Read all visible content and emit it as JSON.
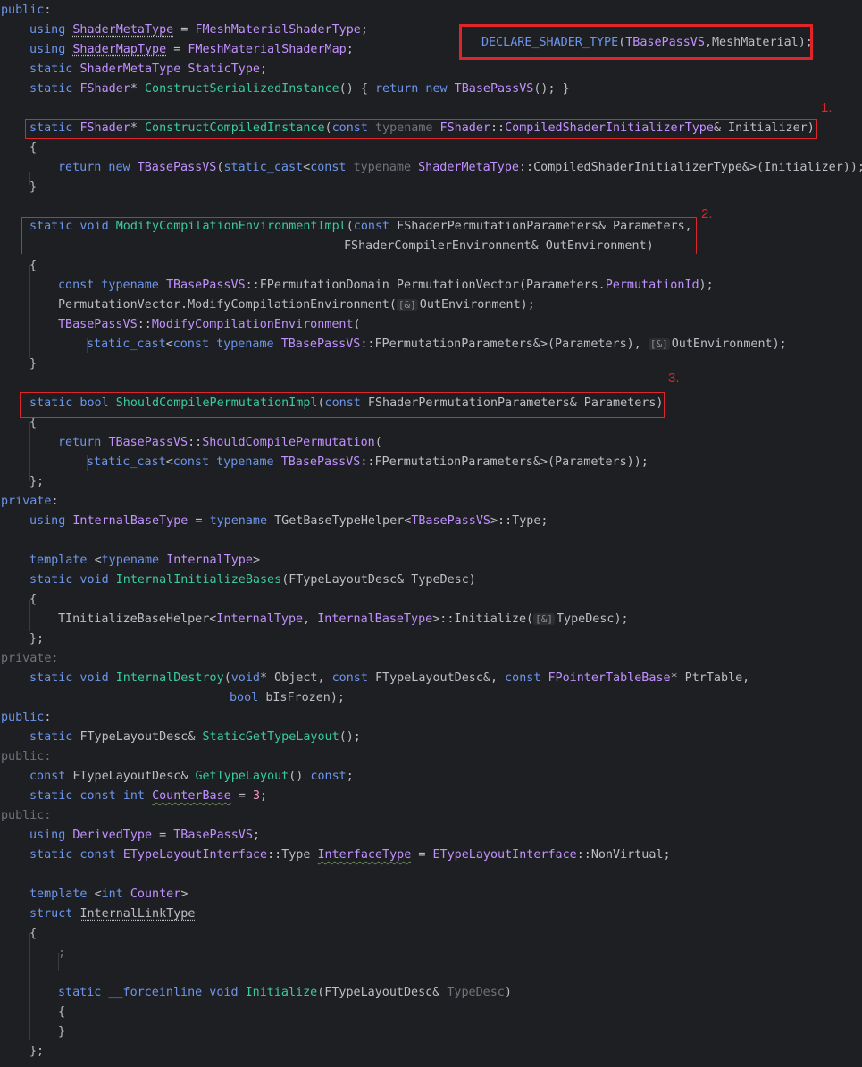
{
  "editor": {
    "background": "#1e1f22",
    "colors": {
      "keyword": "#6c95eb",
      "type": "#c191ff",
      "function": "#39cc9b",
      "number": "#ed94c0",
      "text": "#bcbec4",
      "annotation_red": "#e0242a"
    },
    "lines": [
      {
        "indent": 0,
        "tokens": [
          [
            "kw",
            "public"
          ],
          [
            "text",
            ":"
          ]
        ]
      },
      {
        "indent": 1,
        "tokens": [
          [
            "kw",
            "using "
          ],
          [
            "type-dotted",
            "ShaderMetaType"
          ],
          [
            "text",
            " = "
          ],
          [
            "type",
            "FMeshMaterialShaderType"
          ],
          [
            "text",
            ";"
          ]
        ]
      },
      {
        "indent": 1,
        "tokens": [
          [
            "kw",
            "using "
          ],
          [
            "type-dotted",
            "ShaderMapType"
          ],
          [
            "text",
            " = "
          ],
          [
            "type",
            "FMeshMaterialShaderMap"
          ],
          [
            "text",
            ";"
          ]
        ]
      },
      {
        "indent": 1,
        "tokens": [
          [
            "kw",
            "static "
          ],
          [
            "type",
            "ShaderMetaType "
          ],
          [
            "type",
            "StaticType"
          ],
          [
            "text",
            ";"
          ]
        ]
      },
      {
        "indent": 1,
        "tokens": [
          [
            "kw",
            "static "
          ],
          [
            "type",
            "FShader"
          ],
          [
            "text",
            "* "
          ],
          [
            "fn",
            "ConstructSerializedInstance"
          ],
          [
            "text",
            "() { "
          ],
          [
            "kw",
            "return new "
          ],
          [
            "type",
            "TBasePassVS"
          ],
          [
            "text",
            "(); }"
          ]
        ]
      },
      {
        "indent": 0,
        "tokens": []
      },
      {
        "indent": 1,
        "tokens": [
          [
            "kw",
            "static "
          ],
          [
            "type",
            "FShader"
          ],
          [
            "text",
            "* "
          ],
          [
            "fn",
            "ConstructCompiledInstance"
          ],
          [
            "text",
            "("
          ],
          [
            "kw",
            "const "
          ],
          [
            "dim",
            "typename "
          ],
          [
            "type",
            "FShader"
          ],
          [
            "text",
            "::"
          ],
          [
            "type",
            "CompiledShaderInitializerType"
          ],
          [
            "text",
            "& Initializer)"
          ]
        ]
      },
      {
        "indent": 1,
        "tokens": [
          [
            "text",
            "{"
          ]
        ]
      },
      {
        "indent": 2,
        "tokens": [
          [
            "kw",
            "return new "
          ],
          [
            "type",
            "TBasePassVS"
          ],
          [
            "text",
            "("
          ],
          [
            "kw",
            "static_cast"
          ],
          [
            "text",
            "<"
          ],
          [
            "kw",
            "const "
          ],
          [
            "dim",
            "typename "
          ],
          [
            "type",
            "ShaderMetaType"
          ],
          [
            "text",
            "::"
          ],
          [
            "text",
            "CompiledShaderInitializerType"
          ],
          [
            "text",
            "&>(Initializer));"
          ]
        ]
      },
      {
        "indent": 1,
        "tokens": [
          [
            "text",
            "}"
          ]
        ]
      },
      {
        "indent": 0,
        "tokens": []
      },
      {
        "indent": 1,
        "tokens": [
          [
            "kw",
            "static void "
          ],
          [
            "fn",
            "ModifyCompilationEnvironmentImpl"
          ],
          [
            "text",
            "("
          ],
          [
            "kw",
            "const "
          ],
          [
            "text",
            "FShaderPermutationParameters& Parameters,"
          ]
        ]
      },
      {
        "indent": 12,
        "tokens": [
          [
            "text",
            "FShaderCompilerEnvironment& OutEnvironment)"
          ]
        ]
      },
      {
        "indent": 1,
        "tokens": [
          [
            "text",
            "{"
          ]
        ]
      },
      {
        "indent": 2,
        "tokens": [
          [
            "kw",
            "const typename "
          ],
          [
            "type",
            "TBasePassVS"
          ],
          [
            "text",
            "::FPermutationDomain PermutationVector(Parameters."
          ],
          [
            "type",
            "PermutationId"
          ],
          [
            "text",
            ");"
          ]
        ]
      },
      {
        "indent": 2,
        "tokens": [
          [
            "text",
            "PermutationVector.ModifyCompilationEnvironment("
          ],
          [
            "hint",
            "[&]"
          ],
          [
            "text",
            "OutEnvironment);"
          ]
        ]
      },
      {
        "indent": 2,
        "tokens": [
          [
            "type",
            "TBasePassVS"
          ],
          [
            "text",
            "::"
          ],
          [
            "type",
            "ModifyCompilationEnvironment"
          ],
          [
            "text",
            "("
          ]
        ]
      },
      {
        "indent": 3,
        "tokens": [
          [
            "kw",
            "static_cast"
          ],
          [
            "text",
            "<"
          ],
          [
            "kw",
            "const typename "
          ],
          [
            "type",
            "TBasePassVS"
          ],
          [
            "text",
            "::FPermutationParameters&>(Parameters), "
          ],
          [
            "hint",
            "[&]"
          ],
          [
            "text",
            "OutEnvironment);"
          ]
        ]
      },
      {
        "indent": 1,
        "tokens": [
          [
            "text",
            "}"
          ]
        ]
      },
      {
        "indent": 0,
        "tokens": []
      },
      {
        "indent": 1,
        "tokens": [
          [
            "kw",
            "static bool "
          ],
          [
            "fn",
            "ShouldCompilePermutationImpl"
          ],
          [
            "text",
            "("
          ],
          [
            "kw",
            "const "
          ],
          [
            "text",
            "FShaderPermutationParameters& Parameters)"
          ]
        ]
      },
      {
        "indent": 1,
        "tokens": [
          [
            "text",
            "{"
          ]
        ]
      },
      {
        "indent": 2,
        "tokens": [
          [
            "kw",
            "return "
          ],
          [
            "type",
            "TBasePassVS"
          ],
          [
            "text",
            "::"
          ],
          [
            "type",
            "ShouldCompilePermutation"
          ],
          [
            "text",
            "("
          ]
        ]
      },
      {
        "indent": 3,
        "tokens": [
          [
            "kw",
            "static_cast"
          ],
          [
            "text",
            "<"
          ],
          [
            "kw",
            "const typename "
          ],
          [
            "type",
            "TBasePassVS"
          ],
          [
            "text",
            "::FPermutationParameters&>(Parameters));"
          ]
        ]
      },
      {
        "indent": 1,
        "tokens": [
          [
            "text",
            "};"
          ]
        ]
      },
      {
        "indent": 0,
        "tokens": [
          [
            "kw",
            "private"
          ],
          [
            "text",
            ":"
          ]
        ]
      },
      {
        "indent": 1,
        "tokens": [
          [
            "kw",
            "using "
          ],
          [
            "type",
            "InternalBaseType"
          ],
          [
            "text",
            " = "
          ],
          [
            "kw",
            "typename "
          ],
          [
            "text",
            "TGetBaseTypeHelper<"
          ],
          [
            "type",
            "TBasePassVS"
          ],
          [
            "text",
            ">::Type;"
          ]
        ]
      },
      {
        "indent": 0,
        "tokens": []
      },
      {
        "indent": 1,
        "tokens": [
          [
            "kw",
            "template "
          ],
          [
            "text",
            "<"
          ],
          [
            "kw",
            "typename "
          ],
          [
            "type",
            "InternalType"
          ],
          [
            "text",
            ">"
          ]
        ]
      },
      {
        "indent": 1,
        "tokens": [
          [
            "kw",
            "static void "
          ],
          [
            "fn",
            "InternalInitializeBases"
          ],
          [
            "text",
            "(FTypeLayoutDesc& TypeDesc)"
          ]
        ]
      },
      {
        "indent": 1,
        "tokens": [
          [
            "text",
            "{"
          ]
        ]
      },
      {
        "indent": 2,
        "tokens": [
          [
            "text",
            "TInitializeBaseHelper<"
          ],
          [
            "type",
            "InternalType"
          ],
          [
            "text",
            ", "
          ],
          [
            "type",
            "InternalBaseType"
          ],
          [
            "text",
            ">::Initialize("
          ],
          [
            "hint",
            "[&]"
          ],
          [
            "text",
            "TypeDesc);"
          ]
        ]
      },
      {
        "indent": 1,
        "tokens": [
          [
            "text",
            "};"
          ]
        ]
      },
      {
        "indent": 0,
        "tokens": [
          [
            "dim",
            "private:"
          ]
        ]
      },
      {
        "indent": 1,
        "tokens": [
          [
            "kw",
            "static void "
          ],
          [
            "fn",
            "InternalDestroy"
          ],
          [
            "text",
            "("
          ],
          [
            "kw",
            "void"
          ],
          [
            "text",
            "* Object, "
          ],
          [
            "kw",
            "const "
          ],
          [
            "text",
            "FTypeLayoutDesc&, "
          ],
          [
            "kw",
            "const "
          ],
          [
            "type",
            "FPointerTableBase"
          ],
          [
            "text",
            "* PtrTable,"
          ]
        ]
      },
      {
        "indent": 8,
        "tokens": [
          [
            "kw",
            "bool "
          ],
          [
            "text",
            "bIsFrozen);"
          ]
        ]
      },
      {
        "indent": 0,
        "tokens": [
          [
            "kw",
            "public"
          ],
          [
            "text",
            ":"
          ]
        ]
      },
      {
        "indent": 1,
        "tokens": [
          [
            "kw",
            "static "
          ],
          [
            "text",
            "FTypeLayoutDesc& "
          ],
          [
            "fn",
            "StaticGetTypeLayout"
          ],
          [
            "text",
            "();"
          ]
        ]
      },
      {
        "indent": 0,
        "tokens": [
          [
            "dim",
            "public:"
          ]
        ]
      },
      {
        "indent": 1,
        "tokens": [
          [
            "kw",
            "const "
          ],
          [
            "text",
            "FTypeLayoutDesc& "
          ],
          [
            "fn",
            "GetTypeLayout"
          ],
          [
            "text",
            "() "
          ],
          [
            "kw",
            "const"
          ],
          [
            "text",
            ";"
          ]
        ]
      },
      {
        "indent": 1,
        "tokens": [
          [
            "kw",
            "static const int "
          ],
          [
            "type-wavy",
            "CounterBase"
          ],
          [
            "text",
            " = "
          ],
          [
            "num",
            "3"
          ],
          [
            "text",
            ";"
          ]
        ]
      },
      {
        "indent": 0,
        "tokens": [
          [
            "dim",
            "public:"
          ]
        ]
      },
      {
        "indent": 1,
        "tokens": [
          [
            "kw",
            "using "
          ],
          [
            "type",
            "DerivedType"
          ],
          [
            "text",
            " = "
          ],
          [
            "type",
            "TBasePassVS"
          ],
          [
            "text",
            ";"
          ]
        ]
      },
      {
        "indent": 1,
        "tokens": [
          [
            "kw",
            "static const "
          ],
          [
            "type",
            "ETypeLayoutInterface"
          ],
          [
            "text",
            "::Type "
          ],
          [
            "type-wavy",
            "InterfaceType"
          ],
          [
            "text",
            " = "
          ],
          [
            "type",
            "ETypeLayoutInterface"
          ],
          [
            "text",
            "::NonVirtual;"
          ]
        ]
      },
      {
        "indent": 0,
        "tokens": []
      },
      {
        "indent": 1,
        "tokens": [
          [
            "kw",
            "template "
          ],
          [
            "text",
            "<"
          ],
          [
            "kw",
            "int "
          ],
          [
            "type",
            "Counter"
          ],
          [
            "text",
            ">"
          ]
        ]
      },
      {
        "indent": 1,
        "tokens": [
          [
            "kw",
            "struct "
          ],
          [
            "text-dotted",
            "InternalLinkType"
          ]
        ]
      },
      {
        "indent": 1,
        "tokens": [
          [
            "text",
            "{"
          ]
        ]
      },
      {
        "indent": 2,
        "tokens": [
          [
            "dim",
            ";"
          ]
        ]
      },
      {
        "indent": 0,
        "tokens": []
      },
      {
        "indent": 2,
        "tokens": [
          [
            "kw",
            "static __forceinline void "
          ],
          [
            "fn",
            "Initialize"
          ],
          [
            "text",
            "(FTypeLayoutDesc& "
          ],
          [
            "dim",
            "TypeDesc"
          ],
          [
            "text",
            ")"
          ]
        ]
      },
      {
        "indent": 2,
        "tokens": [
          [
            "text",
            "{"
          ]
        ]
      },
      {
        "indent": 2,
        "tokens": [
          [
            "text",
            "}"
          ]
        ]
      },
      {
        "indent": 1,
        "tokens": [
          [
            "text",
            "};"
          ]
        ]
      }
    ],
    "overlay_macro": {
      "tokens": [
        [
          "macro",
          "DECLARE_SHADER_TYPE"
        ],
        [
          "text",
          "("
        ],
        [
          "type",
          "TBasePassVS"
        ],
        [
          "text",
          ",MeshMaterial);"
        ]
      ]
    },
    "annotations": [
      {
        "label": "1."
      },
      {
        "label": "2."
      },
      {
        "label": "3."
      }
    ]
  }
}
